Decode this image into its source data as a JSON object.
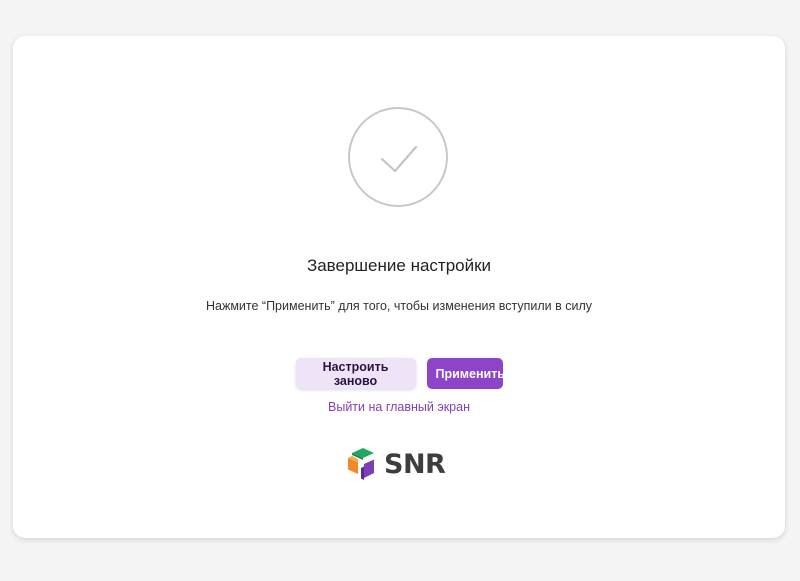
{
  "setup": {
    "title": "Завершение настройки",
    "message": "Нажмите “Применить” для того, чтобы изменения вступили в силу",
    "reconfigure_label": "Настроить заново",
    "apply_label": "Применить",
    "exit_link": "Выйти на главный экран"
  },
  "brand": {
    "name": "SNR",
    "accent": "#8e44c9",
    "accent_light": "#efe3f7",
    "link_color": "#8240b8"
  },
  "icons": {
    "status": "check-icon",
    "logo": "snr-cube-logo"
  }
}
